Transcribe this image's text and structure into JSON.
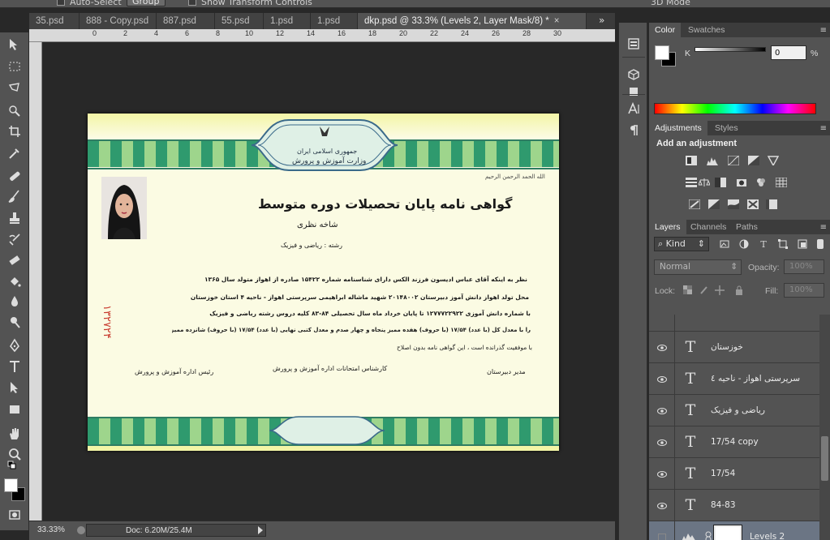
{
  "options_bar": {
    "auto_select_label": "Auto-Select",
    "group_value": "Group",
    "show_transform_label": "Show Transform Controls",
    "workspace_label": "3D Mode"
  },
  "tabs": [
    {
      "label": "35.psd",
      "closable": false
    },
    {
      "label": "888 - Copy.psd",
      "closable": false
    },
    {
      "label": "887.psd",
      "closable": false
    },
    {
      "label": "55.psd",
      "closable": false
    },
    {
      "label": "1.psd",
      "closable": false
    },
    {
      "label": "1.psd",
      "closable": false
    },
    {
      "label": "dkp.psd @ 33.3% (Levels 2, Layer Mask/8) *",
      "closable": true,
      "active": true
    }
  ],
  "tab_close_glyph": "×",
  "tab_overflow_glyph": "»",
  "ruler": {
    "top_numbers": [
      "0",
      "2",
      "4",
      "6",
      "8",
      "10",
      "12",
      "14",
      "16",
      "18",
      "20",
      "22",
      "24",
      "26",
      "28",
      "30"
    ]
  },
  "document": {
    "header_line1": "جمهوری اسلامی ایران",
    "header_line2": "وزارت آموزش و پرورش",
    "title": "گواهی نامه پایان تحصیلات دوره متوسط",
    "branch": "شاخه نظری",
    "major": "رشته : ریاضی و فیزیک",
    "serial": "۱۳۲۷۲۴",
    "top_left_note": "الله الحمد الرحمن الرحیم",
    "row1": "نظر به اینکه آقای   عباس   ادیسون   فرزند   الکس   دارای شناسنامه شماره ۱۵۴۲۲   صادره از  اهواز   متولد سال ۱۳۶۵",
    "row2": "محل تولد  اهواز   دانش آموز   دبیرستان   ۲۰۱۴۸۰۰۲ شهید ماشاله ابراهیمی   سرپرستی اهواز - ناحیه ۴   استان  خوزستان",
    "row3": "با شماره دانش آموزی  ۱۲۷۷۷۲۲۹۲۲   تا پایان  خرداد ماه  سال تحصیلی  ۸۴-۸۳  کلیه دروس رشته  ریاضی و فیزیک",
    "row4": "را با معدل کل (با عدد) ۱۷/۵۴ (با حروف) هفده ممیز پنجاه و چهار صدم  و معدل کتبی نهایی (با عدد) ۱۷/۵۴ (با حروف) شانزده ممیز چهل و نه صدم",
    "row5": "با موفقیت گذرانده است ، این گواهی نامه بدون اصلاح اعطا می شود.",
    "sig_left": "رئیس اداره آموزش و پرورش",
    "sig_mid": "کارشناس امتحانات اداره آموزش و پرورش",
    "sig_right": "مدیر دبیرستان"
  },
  "status": {
    "zoom": "33.33%",
    "doc_info": "Doc: 6.20M/25.4M"
  },
  "panels": {
    "color_tabs": [
      "Color",
      "Swatches"
    ],
    "k_label": "K",
    "k_value": "0",
    "k_unit": "%",
    "adj_tabs": [
      "Adjustments",
      "Styles"
    ],
    "add_adjustment": "Add an adjustment",
    "layers_tabs": [
      "Layers",
      "Channels",
      "Paths"
    ],
    "kind_label": "Kind",
    "blend_mode": "Normal",
    "opacity_label": "Opacity:",
    "opacity_value": "100%",
    "lock_label": "Lock:",
    "fill_label": "Fill:",
    "fill_value": "100%",
    "menu_glyph": "≡"
  },
  "layers": [
    {
      "name": "خوزستان",
      "type": "text",
      "visible": true
    },
    {
      "name": "سرپرستی اهواز - ناحیه ٤",
      "type": "text",
      "visible": true
    },
    {
      "name": "ریاضی و فیزیک",
      "type": "text",
      "visible": true
    },
    {
      "name": "17/54 copy",
      "type": "text",
      "visible": true
    },
    {
      "name": "17/54",
      "type": "text",
      "visible": true
    },
    {
      "name": "84-83",
      "type": "text",
      "visible": true
    },
    {
      "name": "Levels 2",
      "type": "adjustment",
      "visible": false,
      "selected": true
    }
  ],
  "colors": {
    "ui_dark": "#535353",
    "selection": "#6b7584",
    "doc_paper": "#fbfbe3",
    "doc_band_green": "#2f9a6e"
  }
}
